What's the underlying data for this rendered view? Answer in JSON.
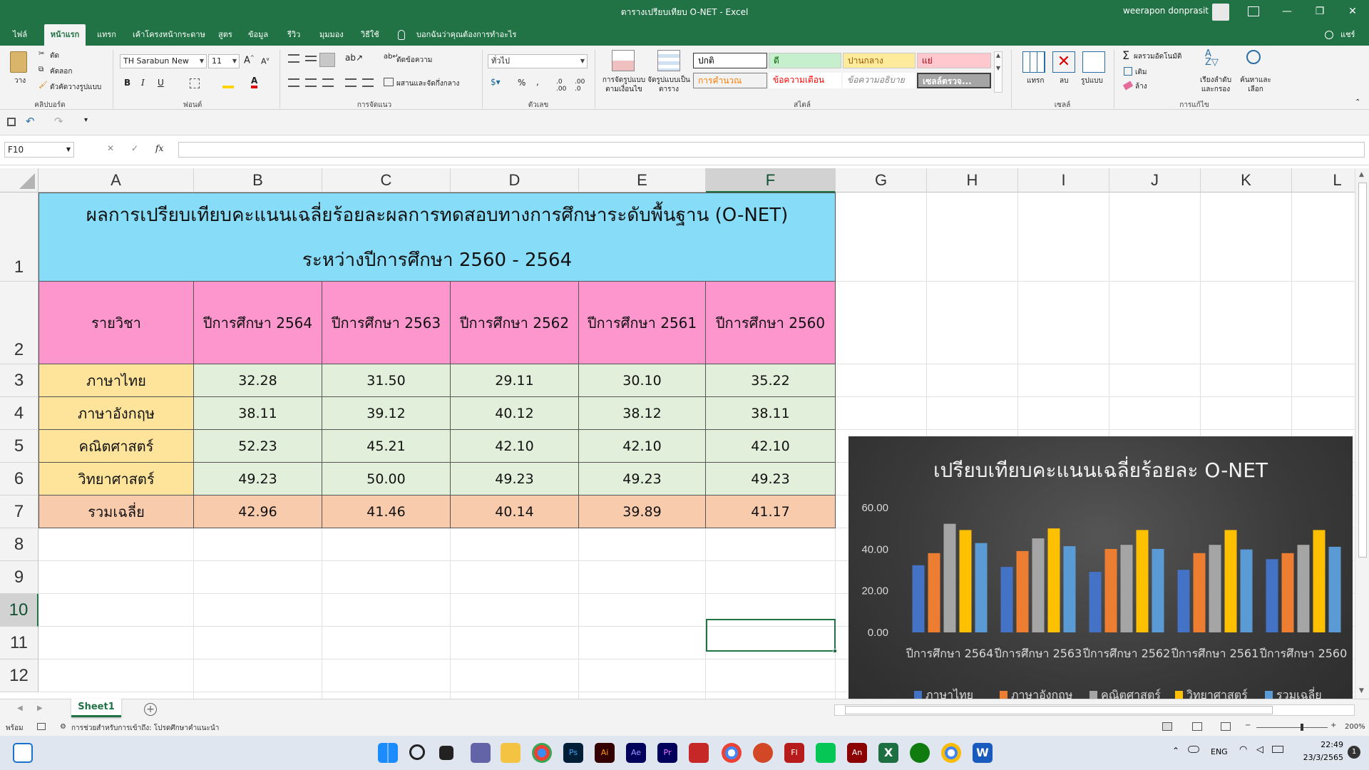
{
  "window": {
    "doc_title": "ตารางเปรียบเทียบ O-NET  -  Excel",
    "user": "weerapon donprasit",
    "controls": [
      "—",
      "❐",
      "✕"
    ]
  },
  "tabs": [
    "ไฟล์",
    "หน้าแรก",
    "แทรก",
    "เค้าโครงหน้ากระดาษ",
    "สูตร",
    "ข้อมูล",
    "รีวิว",
    "มุมมอง",
    "วิธีใช้",
    "บอกฉันว่าคุณต้องการทำอะไร"
  ],
  "share_label": "แชร์",
  "ribbon": {
    "clipboard": {
      "paste": "วาง",
      "cut": "ตัด",
      "copy": "คัดลอก",
      "format_painter": "ตัวคัดวางรูปแบบ",
      "label": "คลิปบอร์ด"
    },
    "font": {
      "name": "TH Sarabun New",
      "size": "11",
      "label": "ฟอนต์",
      "bold": "B",
      "italic": "I",
      "underline": "U"
    },
    "alignment": {
      "wrap": "ตัดข้อความ",
      "merge": "ผสานและจัดกึ่งกลาง",
      "label": "การจัดแนว"
    },
    "number": {
      "format": "ทั่วไป",
      "label": "ตัวเลข"
    },
    "styles": {
      "cond_format": "การจัดรูปแบบตามเงื่อนไข",
      "format_table": "จัดรูปแบบเป็นตาราง",
      "cells": [
        "ปกติ",
        "ดี",
        "ปานกลาง",
        "แย่",
        "การคำนวณ",
        "ข้อความเตือน",
        "ข้อความอธิบาย",
        "เซลล์ตรวจ..."
      ],
      "label": "สไตล์"
    },
    "cells_group": {
      "insert": "แทรก",
      "delete": "ลบ",
      "format": "รูปแบบ",
      "label": "เซลล์"
    },
    "editing": {
      "autosum": "ผลรวมอัตโนมัติ",
      "fill": "เติม",
      "clear": "ล้าง",
      "sort": "เรียงลำดับและกรอง",
      "find": "ค้นหาและเลือก",
      "label": "การแก้ไข"
    }
  },
  "namebox": "F10",
  "formula_icons": [
    "✕",
    "✓",
    "fx"
  ],
  "columns": [
    "A",
    "B",
    "C",
    "D",
    "E",
    "F",
    "G",
    "H",
    "I",
    "J",
    "K",
    "L"
  ],
  "rows": [
    "1",
    "2",
    "3",
    "4",
    "5",
    "6",
    "7",
    "8",
    "9",
    "10",
    "11",
    "12"
  ],
  "table": {
    "title_line1": "ผลการเปรียบเทียบคะแนนเฉลี่ยร้อยละผลการทดสอบทางการศึกษาระดับพื้นฐาน (O-NET)",
    "title_line2": "ระหว่างปีการศึกษา 2560 - 2564",
    "header": [
      "รายวิชา",
      "ปีการศึกษา 2564",
      "ปีการศึกษา 2563",
      "ปีการศึกษา 2562",
      "ปีการศึกษา 2561",
      "ปีการศึกษา 2560"
    ],
    "rows": [
      [
        "ภาษาไทย",
        "32.28",
        "31.50",
        "29.11",
        "30.10",
        "35.22"
      ],
      [
        "ภาษาอังกฤษ",
        "38.11",
        "39.12",
        "40.12",
        "38.12",
        "38.11"
      ],
      [
        "คณิตศาสตร์",
        "52.23",
        "45.21",
        "42.10",
        "42.10",
        "42.10"
      ],
      [
        "วิทยาศาสตร์",
        "49.23",
        "50.00",
        "49.23",
        "49.23",
        "49.23"
      ],
      [
        "รวมเฉลี่ย",
        "42.96",
        "41.46",
        "40.14",
        "39.89",
        "41.17"
      ]
    ]
  },
  "colors": {
    "excel_green": "#217346",
    "title_bg": "#87dcf7",
    "header_bg": "#fc96cd",
    "subject_bg": "#fde49a",
    "value_bg": "#e2efda",
    "total_bg": "#f9cbad"
  },
  "chart_data": {
    "type": "bar",
    "title": "เปรียบเทียบคะแนนเฉลี่ยร้อยละ O-NET",
    "categories": [
      "ปีการศึกษา 2564",
      "ปีการศึกษา 2563",
      "ปีการศึกษา 2562",
      "ปีการศึกษา 2561",
      "ปีการศึกษา 2560"
    ],
    "series": [
      {
        "name": "ภาษาไทย",
        "values": [
          32.28,
          31.5,
          29.11,
          30.1,
          35.22
        ],
        "color": "#4472c4"
      },
      {
        "name": "ภาษาอังกฤษ",
        "values": [
          38.11,
          39.12,
          40.12,
          38.12,
          38.11
        ],
        "color": "#ed7d31"
      },
      {
        "name": "คณิตศาสตร์",
        "values": [
          52.23,
          45.21,
          42.1,
          42.1,
          42.1
        ],
        "color": "#a5a5a5"
      },
      {
        "name": "วิทยาศาสตร์",
        "values": [
          49.23,
          50.0,
          49.23,
          49.23,
          49.23
        ],
        "color": "#ffc000"
      },
      {
        "name": "รวมเฉลี่ย",
        "values": [
          42.96,
          41.46,
          40.14,
          39.89,
          41.17
        ],
        "color": "#5b9bd5"
      }
    ],
    "yticks": [
      "0.00",
      "20.00",
      "40.00",
      "60.00"
    ],
    "ylim": [
      0,
      60
    ],
    "legend_position": "bottom",
    "grid": false
  },
  "sheet_tab": "Sheet1",
  "status": {
    "ready": "พร้อม",
    "accessibility": "การช่วยสำหรับการเข้าถึง: โปรดศึกษาคำแนะนำ",
    "zoom": "200%"
  },
  "taskbar": {
    "lang": "ENG",
    "time": "22:49",
    "date": "23/3/2565",
    "notif": "1"
  }
}
